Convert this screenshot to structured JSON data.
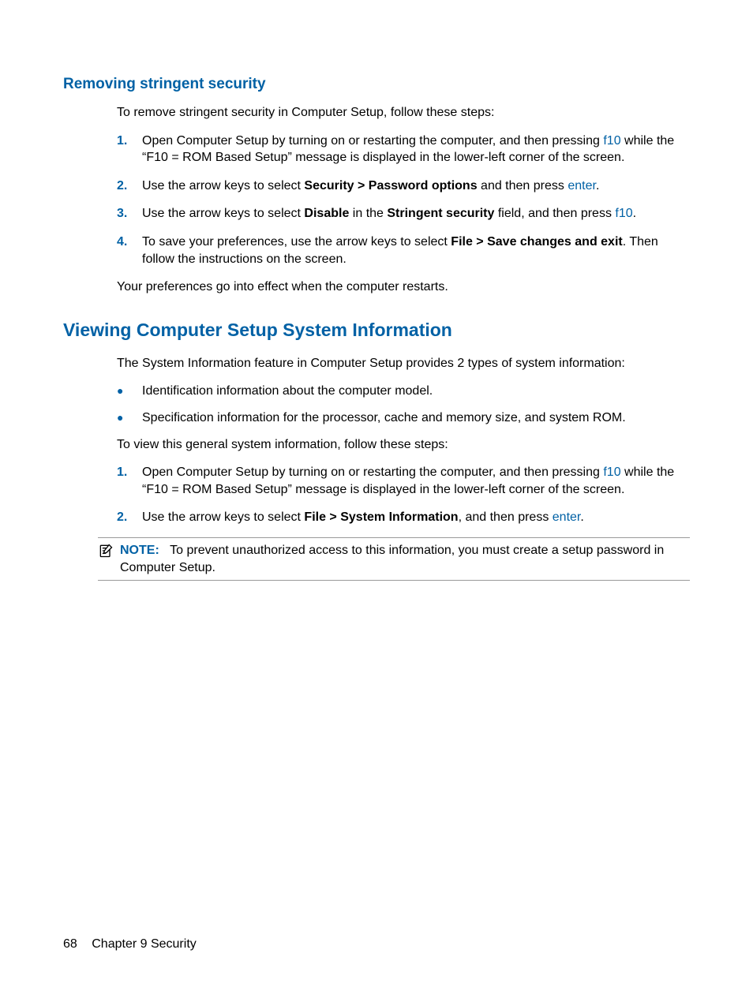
{
  "section1": {
    "heading": "Removing stringent security",
    "intro": "To remove stringent security in Computer Setup, follow these steps:",
    "steps": [
      {
        "num": "1.",
        "pre": "Open Computer Setup by turning on or restarting the computer, and then pressing ",
        "key": "f10",
        "post": " while the “F10 = ROM Based Setup” message is displayed in the lower-left corner of the screen."
      },
      {
        "num": "2.",
        "pre": "Use the arrow keys to select ",
        "bold1": "Security > Password options",
        "mid": " and then press ",
        "key": "enter",
        "post": "."
      },
      {
        "num": "3.",
        "pre": "Use the arrow keys to select ",
        "bold1": "Disable",
        "mid": " in the ",
        "bold2": "Stringent security",
        "mid2": " field, and then press ",
        "key": "f10",
        "post": "."
      },
      {
        "num": "4.",
        "pre": "To save your preferences, use the arrow keys to select ",
        "bold1": "File > Save changes and exit",
        "post": ". Then follow the instructions on the screen."
      }
    ],
    "outro": "Your preferences go into effect when the computer restarts."
  },
  "section2": {
    "heading": "Viewing Computer Setup System Information",
    "intro": "The System Information feature in Computer Setup provides 2 types of system information:",
    "bullets": [
      "Identification information about the computer model.",
      "Specification information for the processor, cache and memory size, and system ROM."
    ],
    "lead": "To view this general system information, follow these steps:",
    "steps": [
      {
        "num": "1.",
        "pre": "Open Computer Setup by turning on or restarting the computer, and then pressing ",
        "key": "f10",
        "post": " while the “F10 = ROM Based Setup” message is displayed in the lower-left corner of the screen."
      },
      {
        "num": "2.",
        "pre": "Use the arrow keys to select ",
        "bold1": "File > System Information",
        "mid": ", and then press ",
        "key": "enter",
        "post": "."
      }
    ],
    "note": {
      "label": "NOTE:",
      "text": "To prevent unauthorized access to this information, you must create a setup password in Computer Setup."
    }
  },
  "footer": {
    "page": "68",
    "chapter": "Chapter 9   Security"
  }
}
